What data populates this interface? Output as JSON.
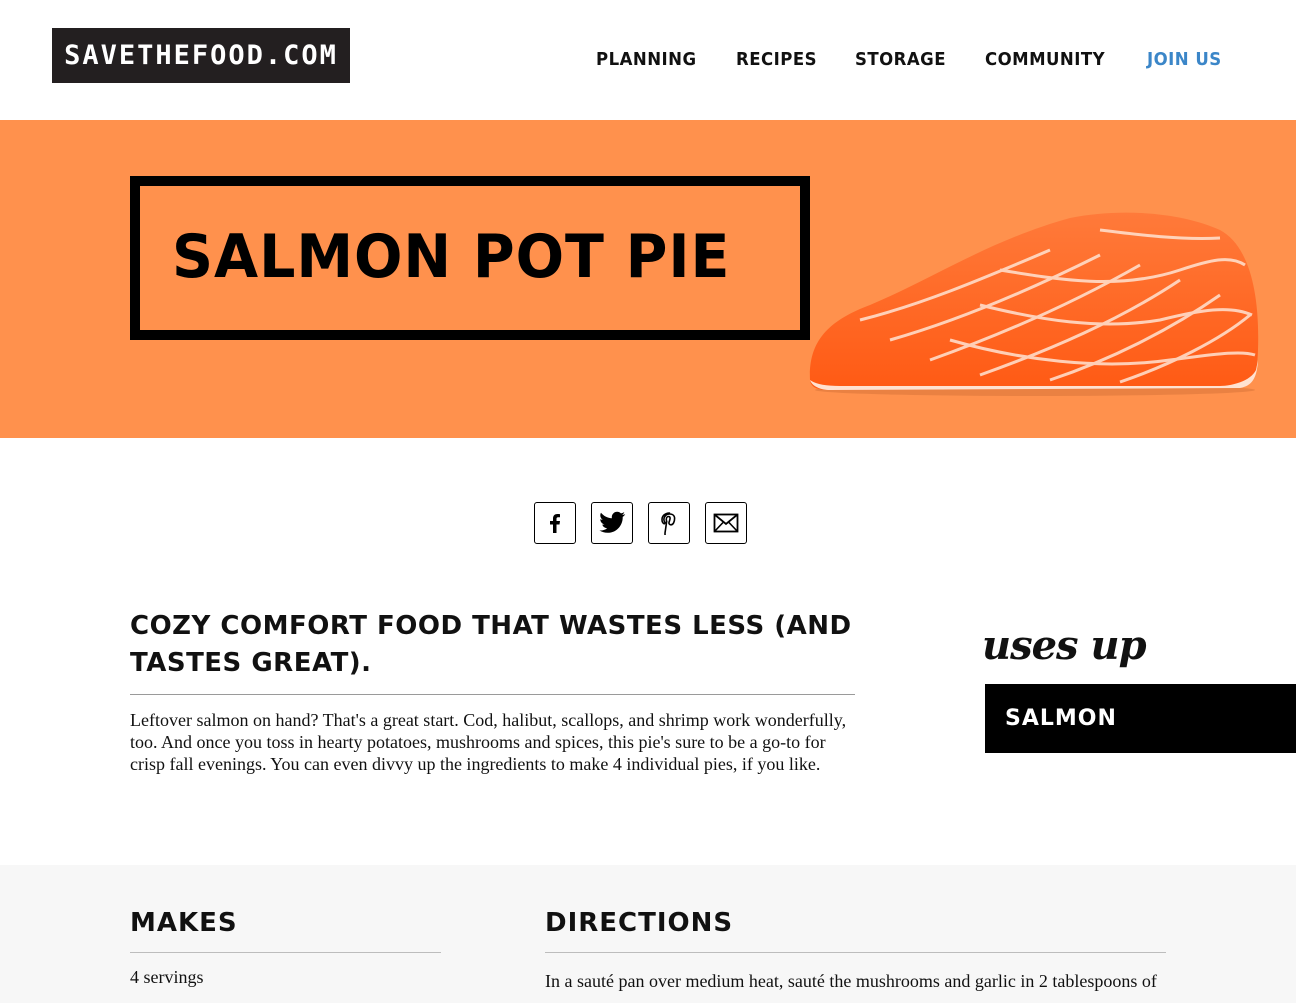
{
  "header": {
    "logo": "SAVETHEFOOD.COM",
    "nav": [
      "PLANNING",
      "RECIPES",
      "STORAGE",
      "COMMUNITY"
    ],
    "join": "JOIN US"
  },
  "hero": {
    "title": "SALMON POT PIE",
    "bg_color": "#ff914d"
  },
  "share": {
    "icons": [
      "facebook-icon",
      "twitter-icon",
      "pinterest-icon",
      "email-icon"
    ]
  },
  "intro": {
    "heading": "COZY COMFORT FOOD THAT WASTES LESS (AND TASTES GREAT).",
    "body": "Leftover salmon on hand? That's a great start. Cod, halibut, scallops, and shrimp work wonderfully, too. And once you toss in hearty potatoes, mushrooms and spices, this pie's sure to be a go-to for crisp fall evenings. You can even divvy up the ingredients to make 4 individual pies, if you like."
  },
  "uses_up": {
    "label": "uses up",
    "item": "SALMON"
  },
  "makes": {
    "heading": "MAKES",
    "value": "4 servings"
  },
  "directions": {
    "heading": "DIRECTIONS",
    "first_line": "In a sauté pan over medium heat, sauté the mushrooms and garlic in 2 tablespoons of"
  },
  "colors": {
    "accent_link": "#3b86c8",
    "logo_bg": "#231f20"
  }
}
